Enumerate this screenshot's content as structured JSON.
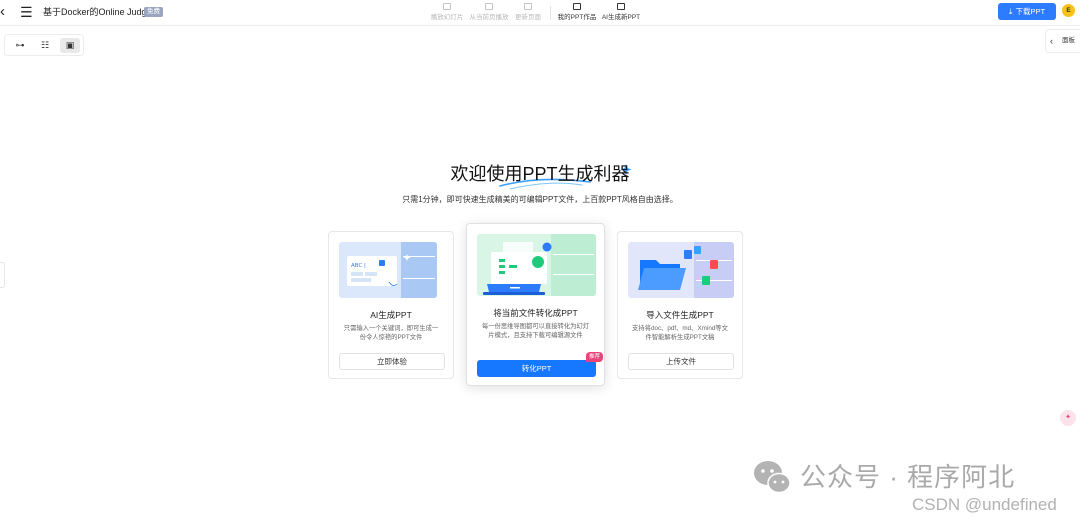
{
  "topbar": {
    "back_icon": "chevron-left-icon",
    "menu_icon": "hamburger-icon",
    "doc_title": "基于Docker的Online Judg...",
    "free_badge": "免费",
    "tools": [
      {
        "label": "播放幻灯片",
        "icon": "play-slides-icon",
        "enabled": false
      },
      {
        "label": "从当前页播放",
        "icon": "play-current-icon",
        "enabled": false
      },
      {
        "label": "更新页面",
        "icon": "refresh-page-icon",
        "enabled": false
      },
      {
        "label": "我的PPT作品",
        "icon": "my-ppt-icon",
        "enabled": true
      },
      {
        "label": "AI生成新PPT",
        "icon": "ai-new-ppt-icon",
        "enabled": true
      }
    ],
    "download_label": "下载PPT",
    "avatar_letter": "E"
  },
  "view_switch": {
    "items": [
      "mindmap-view-icon",
      "outline-view-icon",
      "ppt-view-icon"
    ],
    "active_index": 2
  },
  "panel_tab": {
    "label": "面板"
  },
  "hero": {
    "title": "欢迎使用PPT生成利器",
    "subtitle": "只需1分钟，即可快速生成精美的可编辑PPT文件，上百款PPT风格自由选择。"
  },
  "cards": [
    {
      "title": "AI生成PPT",
      "desc": "只需输入一个关键词，即可生成一份令人惊艳的PPT文件",
      "button": "立即体验",
      "illus_text": "ABC |"
    },
    {
      "title": "将当前文件转化成PPT",
      "desc": "每一份思维导图都可以直接转化为幻灯片模式，且支持下载可编辑源文件",
      "button": "转化PPT",
      "badge": "推荐"
    },
    {
      "title": "导入文件生成PPT",
      "desc": "支持将doc、pdf、md、Xmind等文件智能解析生成PPT文稿",
      "button": "上传文件"
    }
  ],
  "watermark": {
    "line1": "公众号 · 程序阿北",
    "line2": "CSDN @undefined"
  },
  "colors": {
    "accent": "#1677ff",
    "download": "#2d7bff",
    "badge": "#e8447a",
    "avatar": "#f7c21a"
  }
}
